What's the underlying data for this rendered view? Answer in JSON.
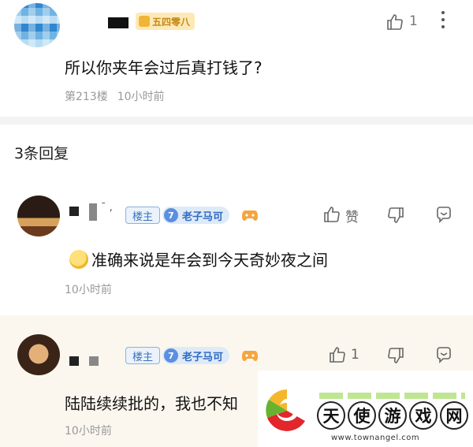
{
  "main_comment": {
    "badge": "五四零八",
    "like_count": "1",
    "text": "所以你夹年会过后真打钱了?",
    "floor": "第213楼",
    "time": "10小时前"
  },
  "replies_header": "3条回复",
  "replies": [
    {
      "op_tag": "楼主",
      "level": "7",
      "level_title": "老子马可",
      "like_label": "赞",
      "text": "准确来说是年会到今天奇妙夜之间",
      "time": "10小时前"
    },
    {
      "op_tag": "楼主",
      "level": "7",
      "level_title": "老子马可",
      "like_count": "1",
      "text": "陆陆续续批的，我也不知",
      "time": "10小时前"
    }
  ],
  "watermark": {
    "title_chars": [
      "天",
      "使",
      "游",
      "戏",
      "网"
    ],
    "url": "www.townangel.com"
  },
  "colors": {
    "accent_blue": "#3a72b8",
    "badge_gold": "#c58a13",
    "meta_gray": "#999999"
  }
}
